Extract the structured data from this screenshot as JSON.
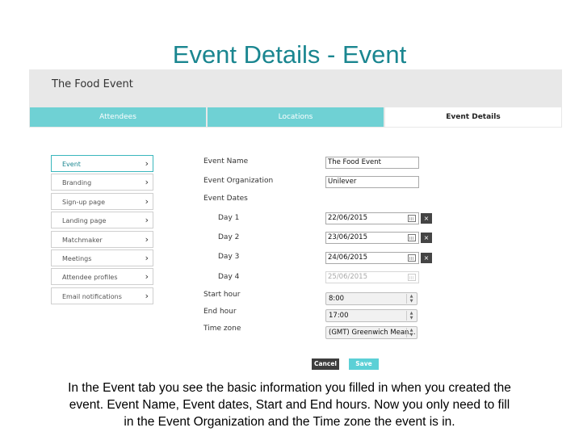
{
  "slide": {
    "title": "Event Details - Event",
    "caption_lines": [
      "In the Event tab you see the basic information you filled in when you created the",
      "event. Event Name, Event dates, Start and End hours. Now you only need to fill",
      "in  the Event Organization and the Time zone the event is in."
    ]
  },
  "app": {
    "event_title": "The Food Event",
    "tabs": [
      "Attendees",
      "Locations",
      "Event Details"
    ],
    "active_tab": "Event Details",
    "colors": {
      "tab_bg": "#6fd1d4",
      "accent": "#1a8690",
      "save": "#5cd0d6",
      "cancel": "#3d3d3d"
    }
  },
  "sidebar": {
    "items": [
      {
        "label": "Event",
        "active": true
      },
      {
        "label": "Branding"
      },
      {
        "label": "Sign-up page"
      },
      {
        "label": "Landing page"
      },
      {
        "label": "Matchmaker"
      },
      {
        "label": "Meetings"
      },
      {
        "label": "Attendee profiles"
      },
      {
        "label": "Email notifications"
      }
    ],
    "chevron_icon": "chevron-right-icon"
  },
  "form": {
    "event_name_label": "Event Name",
    "event_name_value": "The Food Event",
    "organization_label": "Event Organization",
    "organization_value": "Unilever",
    "dates_label": "Event Dates",
    "days": [
      {
        "label": "Day 1",
        "value": "22/06/2015",
        "removable": true
      },
      {
        "label": "Day 2",
        "value": "23/06/2015",
        "removable": true
      },
      {
        "label": "Day 3",
        "value": "24/06/2015",
        "removable": true
      },
      {
        "label": "Day 4",
        "value": "25/06/2015",
        "removable": false,
        "disabled": true
      }
    ],
    "remove_glyph": "×",
    "start_hour_label": "Start hour",
    "start_hour_value": "8:00",
    "end_hour_label": "End hour",
    "end_hour_value": "17:00",
    "timezone_label": "Time zone",
    "timezone_value": "(GMT) Greenwich Mean...",
    "cancel_label": "Cancel",
    "save_label": "Save"
  }
}
